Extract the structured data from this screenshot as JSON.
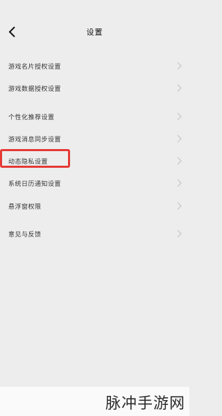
{
  "header": {
    "title": "设置",
    "back_icon": "back-arrow-icon"
  },
  "menu": {
    "items": [
      {
        "label": "游戏名片授权设置"
      },
      {
        "label": "游戏数据授权设置"
      },
      {
        "label": "个性化推荐设置"
      },
      {
        "label": "游戏消息同步设置"
      },
      {
        "label": "动态隐私设置"
      },
      {
        "label": "系统日历通知设置"
      },
      {
        "label": "悬浮窗权限"
      },
      {
        "label": "意见与反馈"
      }
    ],
    "highlighted_item": "动态隐私设置"
  },
  "colors": {
    "background": "#ededed",
    "highlight": "#e53935"
  },
  "watermark": {
    "text": "脉冲手游网"
  }
}
